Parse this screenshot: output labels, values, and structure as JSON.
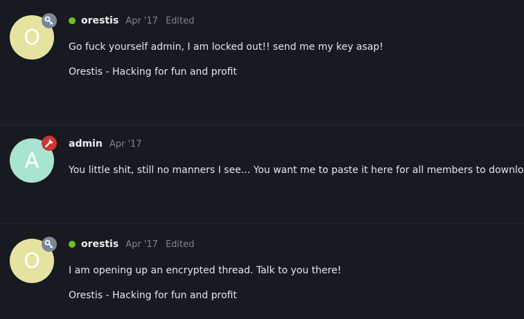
{
  "colors": {
    "background": "#171a20",
    "divider": "#242831",
    "online": "#6fbf1e",
    "avatar_orestis": "#e6e3a1",
    "avatar_admin": "#a9e3d2",
    "badge_key": "#7b8799",
    "badge_admin": "#cc3333",
    "muted_text": "#7d8590"
  },
  "posts": [
    {
      "avatar_letter": "O",
      "badge_icon": "key-icon",
      "online": true,
      "username": "orestis",
      "date": "Apr '17",
      "edited": "Edited",
      "message": "Go fuck yourself admin, I am locked out!! send me my key asap!",
      "signature": "Orestis - Hacking for fun and profit"
    },
    {
      "avatar_letter": "A",
      "badge_icon": "wrench-icon",
      "online": false,
      "username": "admin",
      "date": "Apr '17",
      "message": "You little shit, still no manners I see... You want me to paste it here for all members to download?"
    },
    {
      "avatar_letter": "O",
      "badge_icon": "key-icon",
      "online": true,
      "username": "orestis",
      "date": "Apr '17",
      "edited": "Edited",
      "message": "I am opening up an encrypted thread. Talk to you there!",
      "signature": "Orestis - Hacking for fun and profit"
    }
  ]
}
